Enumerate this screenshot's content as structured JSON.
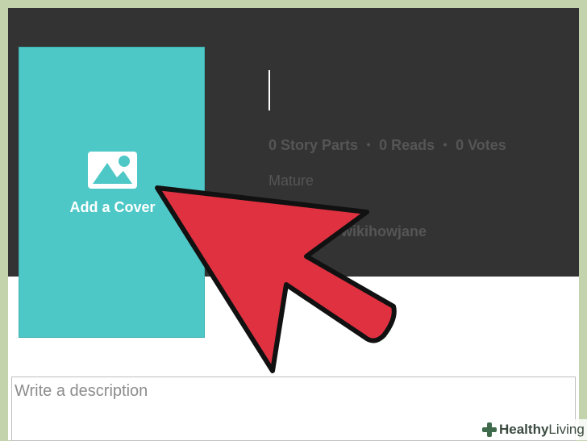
{
  "cover": {
    "label": "Add a Cover",
    "icon": "image-icon",
    "color": "#4ec8c7"
  },
  "story": {
    "title": "",
    "stats": {
      "parts": "0 Story Parts",
      "reads": "0 Reads",
      "votes": "0 Votes",
      "separator": "•"
    },
    "rating": "Mature",
    "author": "wikihowjane"
  },
  "description": {
    "placeholder": "Write a description"
  },
  "annotation": {
    "arrow_color": "#e03140"
  },
  "watermark": {
    "word1": "Healthy",
    "word2": "Living",
    "icon": "plus-cross-icon"
  }
}
